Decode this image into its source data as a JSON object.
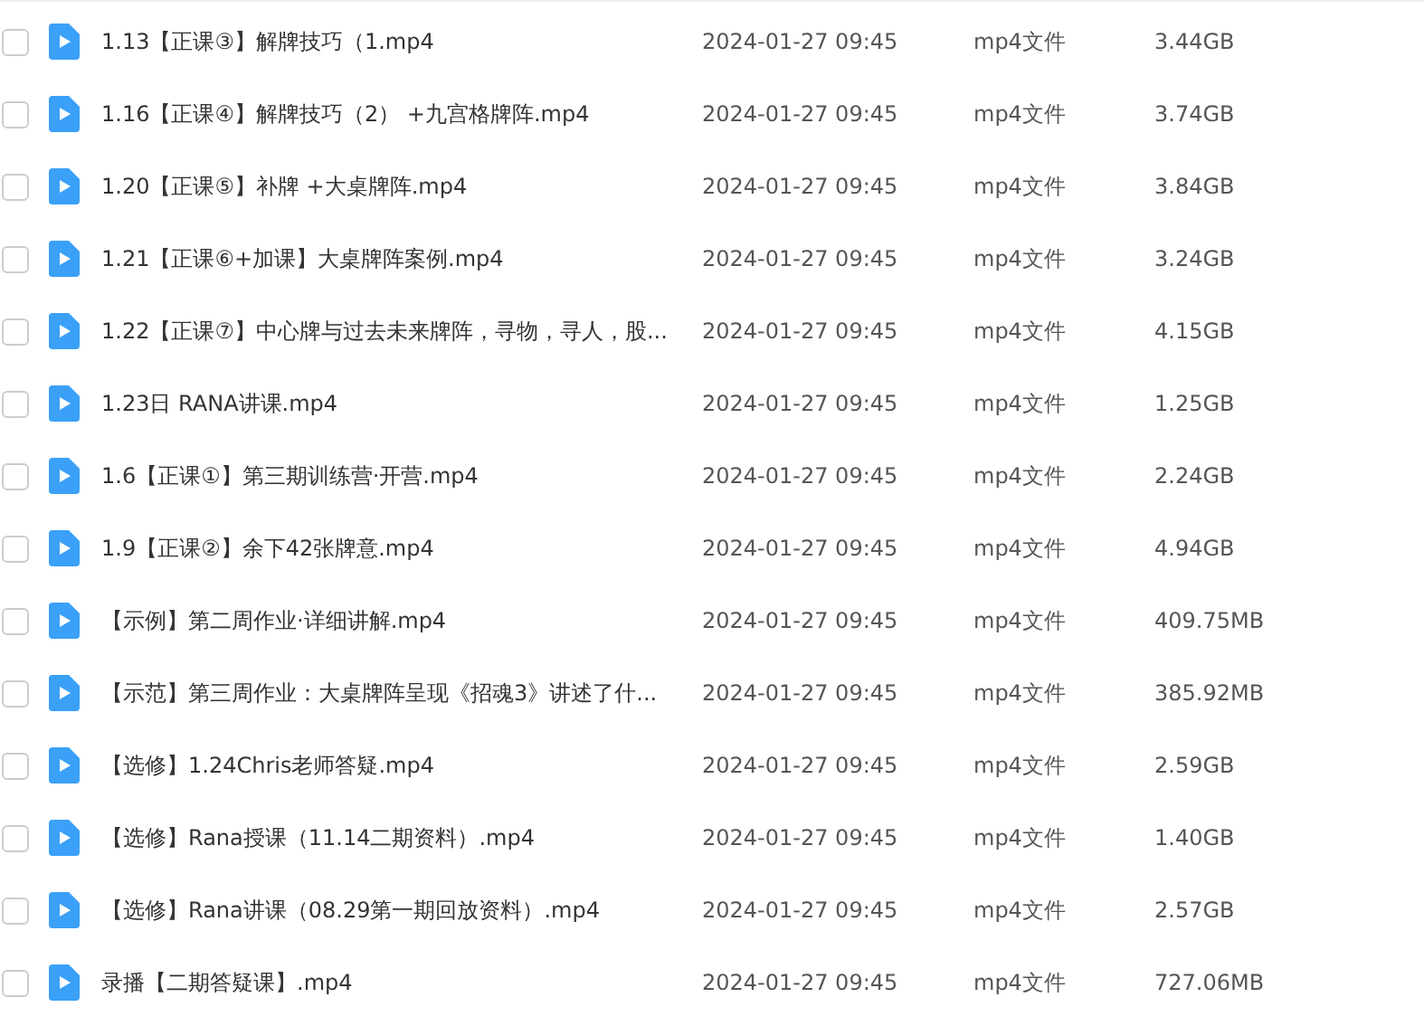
{
  "files": [
    {
      "name": "1.13【正课③】解牌技巧（1.mp4",
      "date": "2024-01-27 09:45",
      "type": "mp4文件",
      "size": "3.44GB",
      "checked": false
    },
    {
      "name": "1.16【正课④】解牌技巧（2） +九宫格牌阵.mp4",
      "date": "2024-01-27 09:45",
      "type": "mp4文件",
      "size": "3.74GB",
      "checked": false
    },
    {
      "name": "1.20【正课⑤】补牌 +大桌牌阵.mp4",
      "date": "2024-01-27 09:45",
      "type": "mp4文件",
      "size": "3.84GB",
      "checked": false
    },
    {
      "name": "1.21【正课⑥+加课】大桌牌阵案例.mp4",
      "date": "2024-01-27 09:45",
      "type": "mp4文件",
      "size": "3.24GB",
      "checked": false
    },
    {
      "name": "1.22【正课⑦】中心牌与过去未来牌阵，寻物，寻人，股...",
      "date": "2024-01-27 09:45",
      "type": "mp4文件",
      "size": "4.15GB",
      "checked": false
    },
    {
      "name": "1.23日 RANA讲课.mp4",
      "date": "2024-01-27 09:45",
      "type": "mp4文件",
      "size": "1.25GB",
      "checked": false
    },
    {
      "name": "1.6【正课①】第三期训练营·开营.mp4",
      "date": "2024-01-27 09:45",
      "type": "mp4文件",
      "size": "2.24GB",
      "checked": false
    },
    {
      "name": "1.9【正课②】余下42张牌意.mp4",
      "date": "2024-01-27 09:45",
      "type": "mp4文件",
      "size": "4.94GB",
      "checked": false
    },
    {
      "name": "【示例】第二周作业·详细讲解.mp4",
      "date": "2024-01-27 09:45",
      "type": "mp4文件",
      "size": "409.75MB",
      "checked": false
    },
    {
      "name": "【示范】第三周作业：大桌牌阵呈现《招魂3》讲述了什...",
      "date": "2024-01-27 09:45",
      "type": "mp4文件",
      "size": "385.92MB",
      "checked": false
    },
    {
      "name": "【选修】1.24Chris老师答疑.mp4",
      "date": "2024-01-27 09:45",
      "type": "mp4文件",
      "size": "2.59GB",
      "checked": false
    },
    {
      "name": "【选修】Rana授课（11.14二期资料）.mp4",
      "date": "2024-01-27 09:45",
      "type": "mp4文件",
      "size": "1.40GB",
      "checked": false
    },
    {
      "name": "【选修】Rana讲课（08.29第一期回放资料）.mp4",
      "date": "2024-01-27 09:45",
      "type": "mp4文件",
      "size": "2.57GB",
      "checked": false
    },
    {
      "name": "录播【二期答疑课】.mp4",
      "date": "2024-01-27 09:45",
      "type": "mp4文件",
      "size": "727.06MB",
      "checked": false
    }
  ]
}
